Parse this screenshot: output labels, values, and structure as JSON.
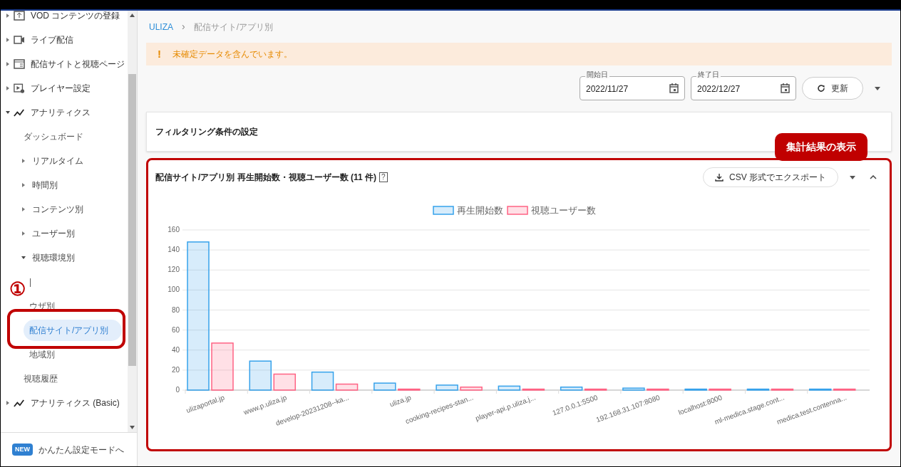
{
  "sidebar": {
    "items": [
      {
        "label": "VOD コンテンツの登録",
        "kind": "section",
        "expanded": false
      },
      {
        "label": "ライブ配信",
        "kind": "section",
        "expanded": false
      },
      {
        "label": "配信サイトと視聴ページ",
        "kind": "section",
        "expanded": false
      },
      {
        "label": "プレイヤー設定",
        "kind": "section",
        "expanded": false
      },
      {
        "label": "アナリティクス",
        "kind": "section",
        "expanded": true,
        "children": [
          {
            "label": "ダッシュボード",
            "kind": "link",
            "selected": false
          },
          {
            "label": "リアルタイム",
            "kind": "group",
            "expanded": false
          },
          {
            "label": "時間別",
            "kind": "group",
            "expanded": false
          },
          {
            "label": "コンテンツ別",
            "kind": "group",
            "expanded": false
          },
          {
            "label": "ユーザー別",
            "kind": "group",
            "expanded": false
          },
          {
            "label": "視聴環境別",
            "kind": "group",
            "expanded": true,
            "children": [
              {
                "label": "|",
                "kind": "link",
                "selected": false
              },
              {
                "label": "ウザ別",
                "kind": "link",
                "selected": false
              },
              {
                "label": "配信サイト/アプリ別",
                "kind": "link",
                "selected": true
              },
              {
                "label": "地域別",
                "kind": "link",
                "selected": false
              }
            ]
          },
          {
            "label": "視聴履歴",
            "kind": "link",
            "selected": false
          }
        ]
      },
      {
        "label": "アナリティクス (Basic)",
        "kind": "section",
        "expanded": false
      }
    ],
    "footer": {
      "badge": "NEW",
      "label": "かんたん設定モードへ"
    }
  },
  "breadcrumb": {
    "items": [
      "ULIZA",
      "配信サイト/アプリ別"
    ],
    "separator": "›"
  },
  "alert": {
    "icon": "!",
    "message": "未確定データを含んでいます。"
  },
  "date_range": {
    "start": {
      "label": "開始日",
      "value": "2022/11/27"
    },
    "end": {
      "label": "終了日",
      "value": "2022/12/27"
    },
    "refresh": "更新"
  },
  "filter_panel": {
    "title": "フィルタリング条件の設定"
  },
  "result_panel": {
    "title": "配信サイト/アプリ別 再生開始数・視聴ユーザー数 (11 件)",
    "help": "?",
    "export": "CSV 形式でエクスポート",
    "chart_data": {
      "type": "bar",
      "grid": true,
      "legend": true,
      "categories": [
        "ulizaportal.jp",
        "www.p.uliza.jp",
        "develop-20231208--ka...",
        "uliza.jp",
        "cooking-recipes-stan...",
        "player-api.p.uliza.j...",
        "127.0.0.1:5500",
        "192.168.31.107:8080",
        "localhost:8000",
        "ml-medica.stage.cont...",
        "medica.test.contenna..."
      ],
      "series": [
        {
          "name": "再生開始数",
          "color": "#36a2eb",
          "values": [
            148,
            29,
            18,
            7,
            5,
            4,
            3,
            2,
            1,
            1,
            1
          ]
        },
        {
          "name": "視聴ユーザー数",
          "color": "#ff6384",
          "values": [
            47,
            16,
            6,
            1,
            3,
            1,
            1,
            1,
            1,
            1,
            1
          ]
        }
      ],
      "ylim": [
        0,
        160
      ],
      "yticks": [
        0,
        20,
        40,
        60,
        80,
        100,
        120,
        140,
        160
      ]
    }
  },
  "annotations": {
    "marker": "①",
    "callout": "集計結果の表示"
  }
}
